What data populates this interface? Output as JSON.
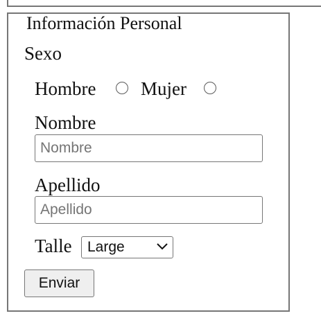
{
  "form": {
    "legend": "Información Personal",
    "sex_label": "Sexo",
    "options": [
      {
        "label": "Hombre",
        "checked": false
      },
      {
        "label": "Mujer",
        "checked": false
      }
    ],
    "name_label": "Nombre",
    "name_placeholder": "Nombre",
    "name_value": "",
    "surname_label": "Apellido",
    "surname_placeholder": "Apellido",
    "surname_value": "",
    "size_label": "Talle",
    "size_selected": "Large",
    "submit_label": "Enviar"
  },
  "icons": {
    "select_arrow": "chevron-down-icon"
  },
  "colors": {
    "border": "#767676",
    "placeholder": "#757575",
    "button_bg": "#efefef"
  }
}
